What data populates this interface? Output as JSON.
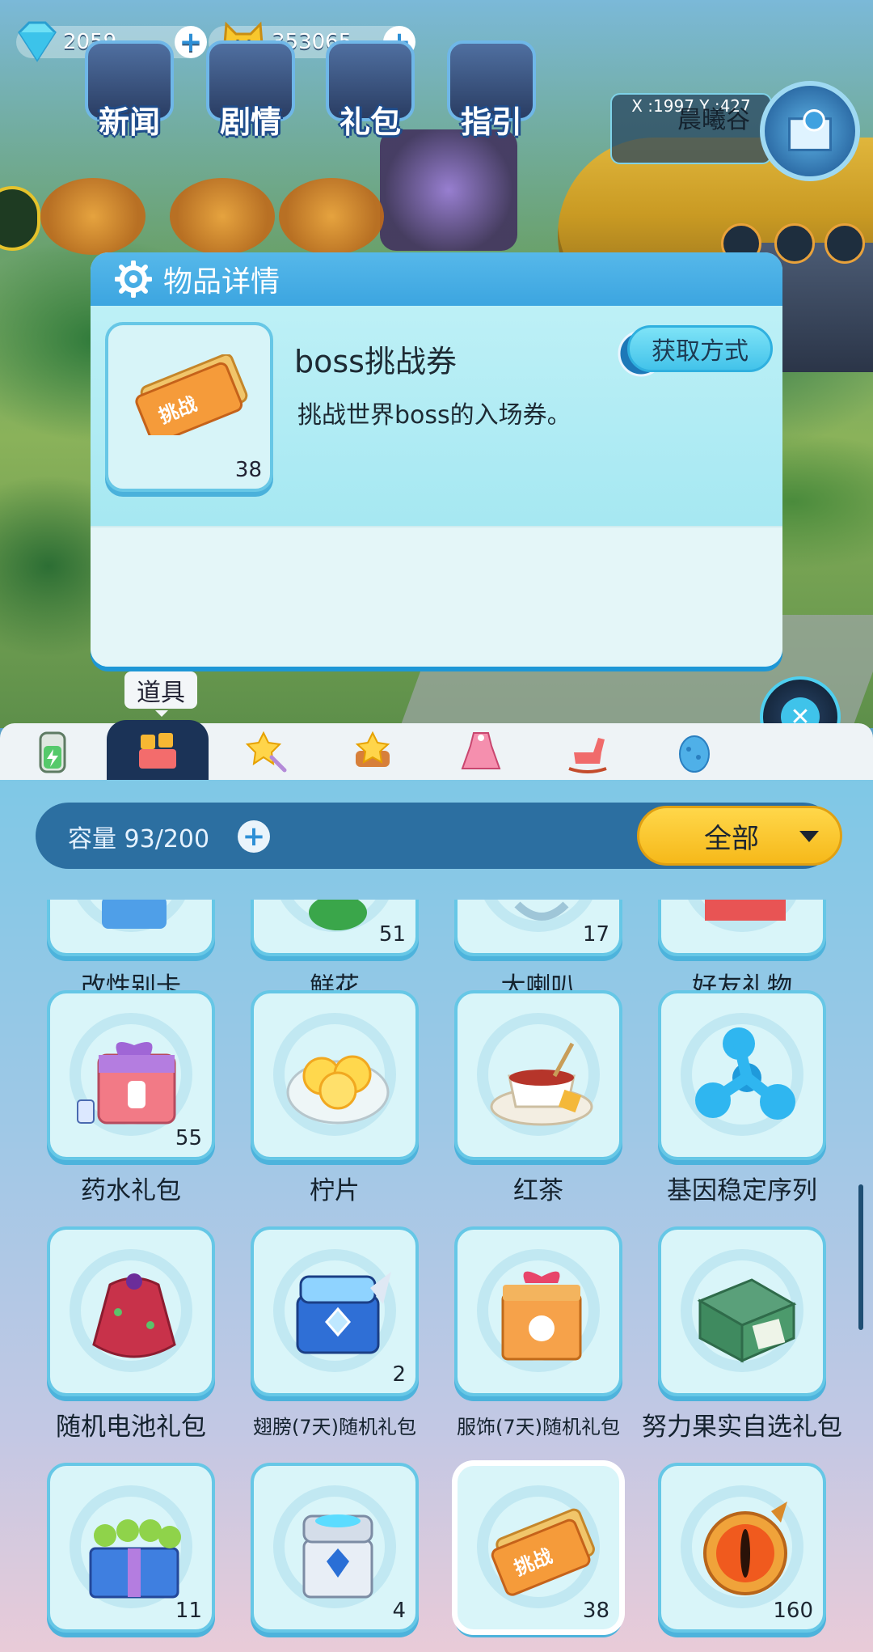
{
  "hud": {
    "diamonds": "2059",
    "coins": "353065",
    "menu": [
      {
        "label": "新闻"
      },
      {
        "label": "剧情"
      },
      {
        "label": "礼包"
      },
      {
        "label": "指引"
      }
    ],
    "location": {
      "name": "晨曦谷",
      "coords": "X :1997,Y :427"
    }
  },
  "detail": {
    "title": "物品详情",
    "item_name": "boss挑战券",
    "item_count": "38",
    "obtain_button": "获取方式",
    "description": "挑战世界boss的入场券。"
  },
  "bag": {
    "active_tab_label": "道具",
    "tabs": [
      "battery-icon",
      "props-icon",
      "star-wand-icon",
      "star-badge-icon",
      "dress-icon",
      "rocking-horse-icon",
      "egg-icon"
    ],
    "capacity_label": "容量 93/200",
    "filter": "全部",
    "rows": [
      [
        {
          "name": "改性别卡",
          "count": ""
        },
        {
          "name": "鲜花",
          "count": "51"
        },
        {
          "name": "大喇叭",
          "count": "17"
        },
        {
          "name": "好友礼物",
          "count": ""
        }
      ],
      [
        {
          "name": "药水礼包",
          "count": "55"
        },
        {
          "name": "柠片",
          "count": ""
        },
        {
          "name": "红茶",
          "count": ""
        },
        {
          "name": "基因稳定序列",
          "count": ""
        }
      ],
      [
        {
          "name": "随机电池礼包",
          "count": ""
        },
        {
          "name": "翅膀(7天)随机礼包",
          "count": "2"
        },
        {
          "name": "服饰(7天)随机礼包",
          "count": ""
        },
        {
          "name": "努力果实自选礼包",
          "count": ""
        }
      ],
      [
        {
          "name": "",
          "count": "11"
        },
        {
          "name": "",
          "count": "4"
        },
        {
          "name": "",
          "count": "38"
        },
        {
          "name": "",
          "count": "160"
        }
      ]
    ]
  },
  "colors": {
    "accent": "#3ca5e0",
    "filter": "#f6b91a",
    "panel_dark": "#2c6fa1"
  }
}
